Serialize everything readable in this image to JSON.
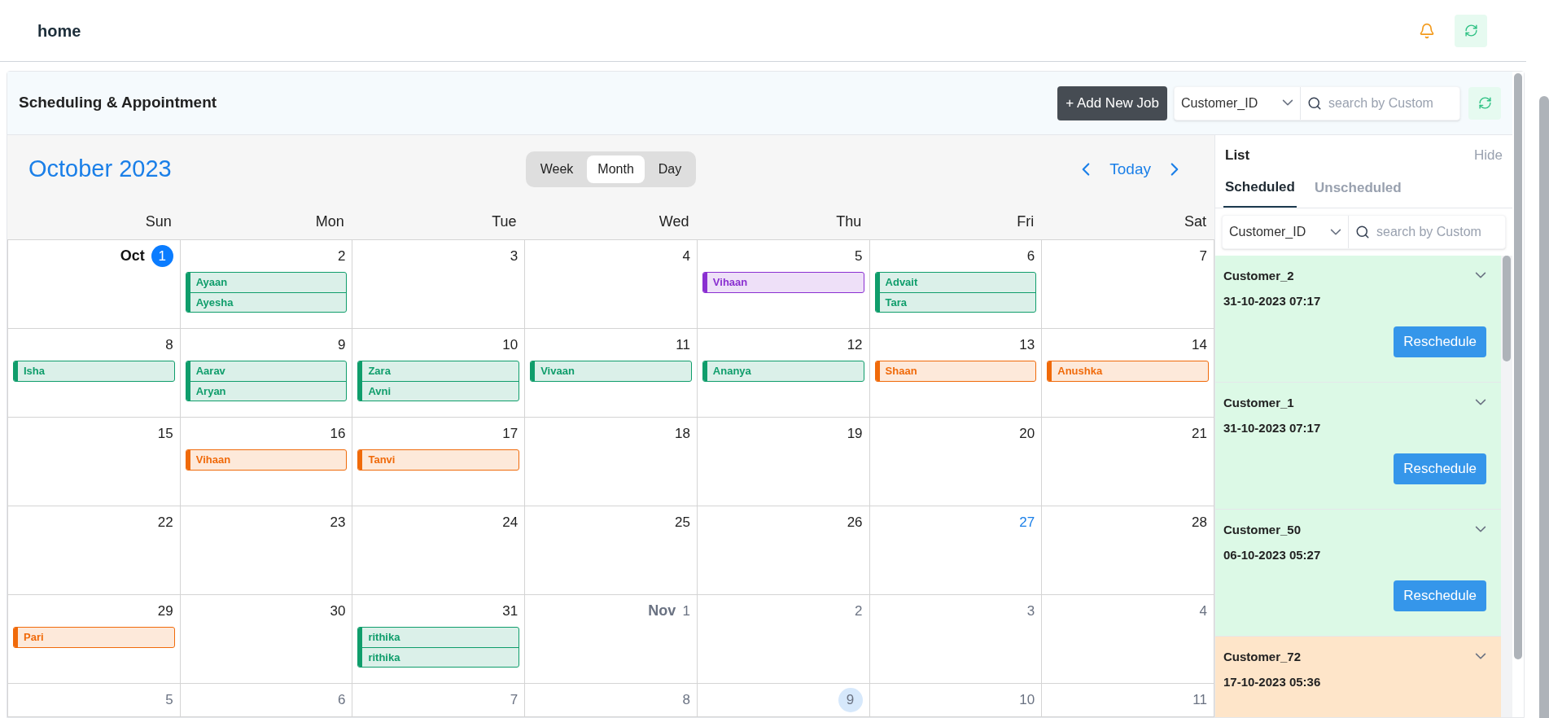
{
  "top_bar": {
    "title": "home"
  },
  "card": {
    "title": "Scheduling & Appointment",
    "add_button": "+ Add New Job",
    "filter": {
      "value": "Customer_ID",
      "placeholder": "search by Custom"
    }
  },
  "calendar": {
    "title": "October 2023",
    "views": [
      {
        "label": "Week",
        "selected": false
      },
      {
        "label": "Month",
        "selected": true
      },
      {
        "label": "Day",
        "selected": false
      }
    ],
    "today_button": "Today",
    "weekdays": [
      "Sun",
      "Mon",
      "Tue",
      "Wed",
      "Thu",
      "Fri",
      "Sat"
    ],
    "weeks": [
      [
        {
          "day": "1",
          "month_label": "Oct",
          "kind": "first"
        },
        {
          "day": "2",
          "events": [
            {
              "name": "Ayaan",
              "color": "#0f9d6b"
            },
            {
              "name": "Ayesha",
              "color": "#0f9d6b"
            }
          ]
        },
        {
          "day": "3"
        },
        {
          "day": "4"
        },
        {
          "day": "5",
          "events": [
            {
              "name": "Vihaan",
              "color": "#8a2fd1"
            }
          ]
        },
        {
          "day": "6",
          "events": [
            {
              "name": "Advait",
              "color": "#0f9d6b"
            },
            {
              "name": "Tara",
              "color": "#0f9d6b"
            }
          ]
        },
        {
          "day": "7"
        }
      ],
      [
        {
          "day": "8",
          "events": [
            {
              "name": "Isha",
              "color": "#0f9d6b"
            }
          ]
        },
        {
          "day": "9",
          "events": [
            {
              "name": "Aarav",
              "color": "#0f9d6b"
            },
            {
              "name": "Aryan",
              "color": "#0f9d6b"
            }
          ]
        },
        {
          "day": "10",
          "events": [
            {
              "name": "Zara",
              "color": "#0f9d6b"
            },
            {
              "name": "Avni",
              "color": "#0f9d6b"
            }
          ]
        },
        {
          "day": "11",
          "events": [
            {
              "name": "Vivaan",
              "color": "#0f9d6b"
            }
          ]
        },
        {
          "day": "12",
          "events": [
            {
              "name": "Ananya",
              "color": "#0f9d6b"
            }
          ]
        },
        {
          "day": "13",
          "events": [
            {
              "name": "Shaan",
              "color": "#f06a0a"
            }
          ]
        },
        {
          "day": "14",
          "events": [
            {
              "name": "Anushka",
              "color": "#f06a0a"
            }
          ]
        }
      ],
      [
        {
          "day": "15"
        },
        {
          "day": "16",
          "events": [
            {
              "name": "Vihaan",
              "color": "#f06a0a"
            }
          ]
        },
        {
          "day": "17",
          "events": [
            {
              "name": "Tanvi",
              "color": "#f06a0a"
            }
          ]
        },
        {
          "day": "18"
        },
        {
          "day": "19"
        },
        {
          "day": "20"
        },
        {
          "day": "21"
        }
      ],
      [
        {
          "day": "22"
        },
        {
          "day": "23"
        },
        {
          "day": "24"
        },
        {
          "day": "25"
        },
        {
          "day": "26"
        },
        {
          "day": "27",
          "kind": "today"
        },
        {
          "day": "28"
        }
      ],
      [
        {
          "day": "29",
          "events": [
            {
              "name": "Pari",
              "color": "#f06a0a"
            }
          ]
        },
        {
          "day": "30"
        },
        {
          "day": "31",
          "events": [
            {
              "name": "rithika",
              "color": "#0f9d6b"
            },
            {
              "name": "rithika",
              "color": "#0f9d6b"
            }
          ]
        },
        {
          "day": "1",
          "month_label": "Nov",
          "kind": "other"
        },
        {
          "day": "2",
          "kind": "other"
        },
        {
          "day": "3",
          "kind": "other"
        },
        {
          "day": "4",
          "kind": "other"
        }
      ],
      [
        {
          "day": "5",
          "kind": "other"
        },
        {
          "day": "6",
          "kind": "other"
        },
        {
          "day": "7",
          "kind": "other"
        },
        {
          "day": "8",
          "kind": "other"
        },
        {
          "day": "9",
          "kind": "marked"
        },
        {
          "day": "10",
          "kind": "other"
        },
        {
          "day": "11",
          "kind": "other"
        }
      ]
    ]
  },
  "list_panel": {
    "title": "List",
    "hide_link": "Hide",
    "tabs": [
      {
        "label": "Scheduled",
        "selected": true
      },
      {
        "label": "Unscheduled",
        "selected": false
      }
    ],
    "filter": {
      "value": "Customer_ID",
      "placeholder": "search by Custom"
    },
    "items": [
      {
        "customer": "Customer_2",
        "datetime": "31-10-2023 07:17",
        "button": "Reschedule",
        "color": "#dcf9e6"
      },
      {
        "customer": "Customer_1",
        "datetime": "31-10-2023 07:17",
        "button": "Reschedule",
        "color": "#dcf9e6"
      },
      {
        "customer": "Customer_50",
        "datetime": "06-10-2023 05:27",
        "button": "Reschedule",
        "color": "#dcf9e6"
      },
      {
        "customer": "Customer_72",
        "datetime": "17-10-2023 05:36",
        "color": "#fee5c9"
      }
    ]
  }
}
